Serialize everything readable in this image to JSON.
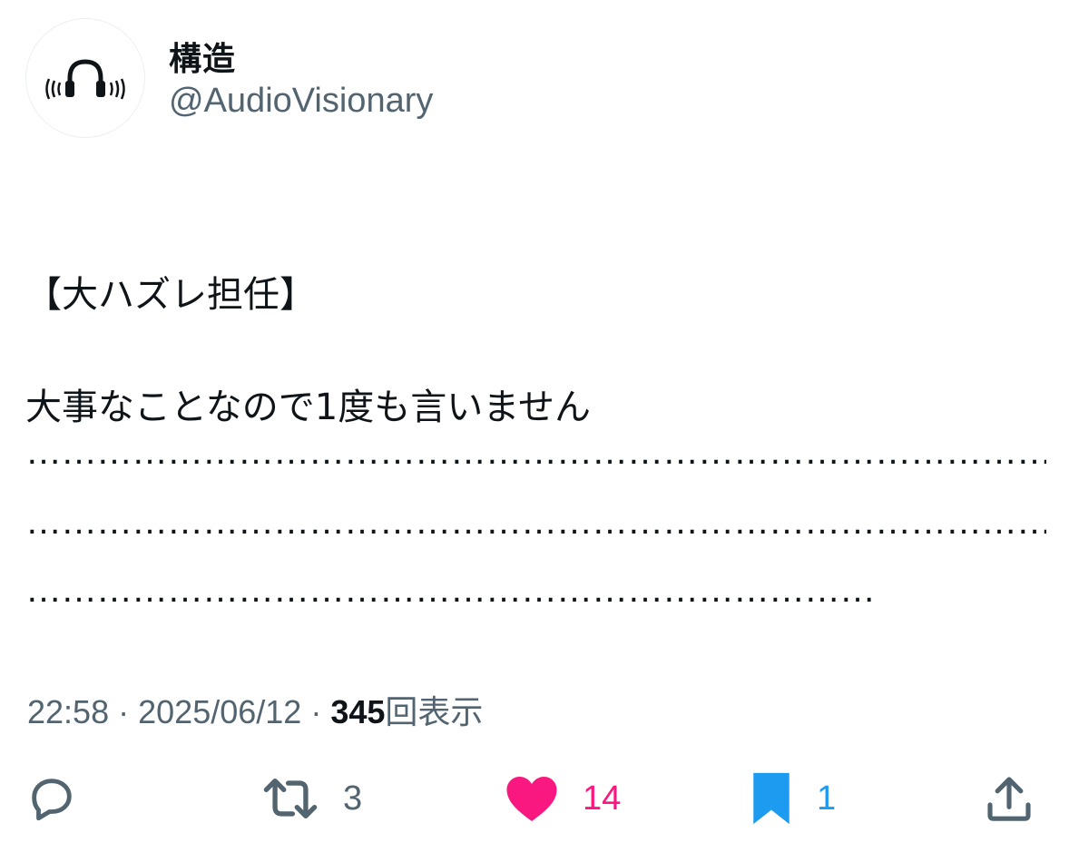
{
  "author": {
    "display_name": "構造",
    "handle": "@AudioVisionary",
    "avatar_icon": "headphones-logo-icon"
  },
  "tweet": {
    "lines": [
      "【大ハズレ担任】",
      "大事なことなので1度も言いません"
    ],
    "dot_lines": [
      "………………………………………………………………………………………",
      "………………………………………………………………………………………",
      "…………………………………………………………………………"
    ]
  },
  "meta": {
    "time": "22:58",
    "separator": "·",
    "date": "2025/06/12",
    "views_count": "345",
    "views_label": "回表示"
  },
  "actions": {
    "reply": {
      "icon": "reply-icon",
      "count": ""
    },
    "retweet": {
      "icon": "retweet-icon",
      "count": "3",
      "color": "#536471"
    },
    "like": {
      "icon": "heart-icon",
      "count": "14",
      "color": "#f91880"
    },
    "bookmark": {
      "icon": "bookmark-icon",
      "count": "1",
      "color": "#1d9bf0"
    },
    "share": {
      "icon": "share-icon"
    }
  }
}
